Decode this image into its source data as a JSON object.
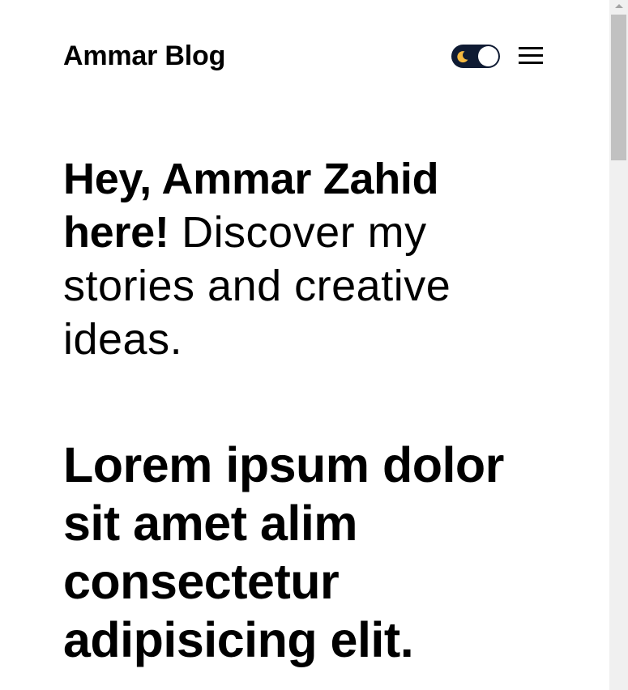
{
  "header": {
    "site_title": "Ammar Blog",
    "theme_toggle": {
      "mode": "dark",
      "icon": "moon-icon",
      "track_color": "#0f1b33",
      "moon_color": "#f5b940"
    },
    "menu_icon": "hamburger-icon"
  },
  "intro": {
    "greeting": "Hey, Ammar Zahid here!",
    "tagline": " Discover my stories and creative ideas."
  },
  "posts": [
    {
      "title": "Lorem ipsum dolor sit amet alim consectetur adipisicing elit."
    }
  ]
}
